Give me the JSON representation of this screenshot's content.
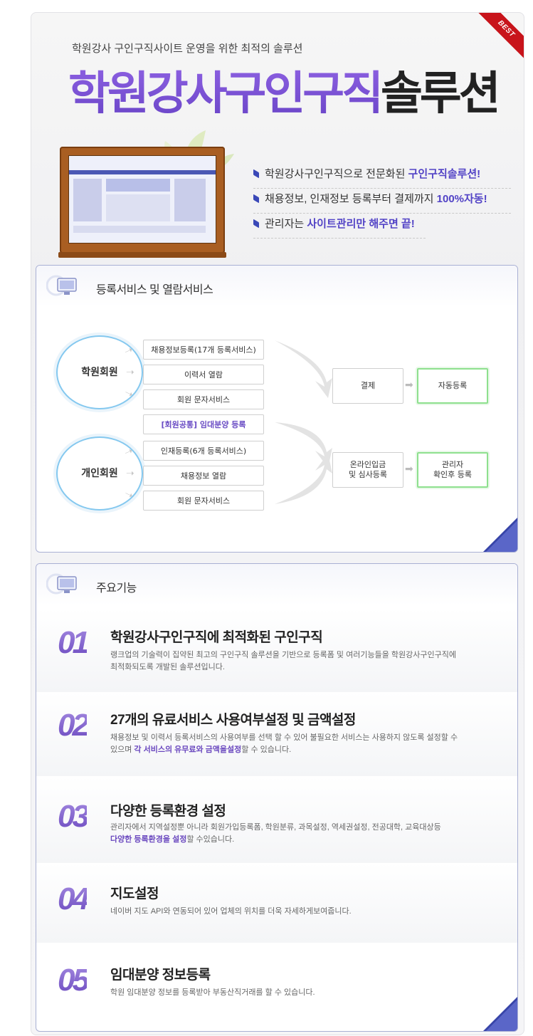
{
  "badge": "BEST",
  "hero": {
    "subtitle": "학원강사 구인구직사이트 운영을 위한 최적의 솔루션",
    "title_purple": "학원강사구인구직",
    "title_black": "솔루션",
    "bullets": [
      {
        "pre": "학원강사구인구직으로 전문화된 ",
        "hl": "구인구직솔루션!",
        "post": ""
      },
      {
        "pre": "채용정보, 인재정보 등록부터 결제까지 ",
        "hl": "100%자동!",
        "post": ""
      },
      {
        "pre": "관리자는 ",
        "hl": "사이트관리만 해주면 끝!",
        "post": ""
      }
    ]
  },
  "section1": {
    "title": "등록서비스 및 열람서비스",
    "member_academy": "학원회원",
    "member_personal": "개인회원",
    "academy_services": [
      "채용정보등록(17개 등록서비스)",
      "이력서 열람",
      "회원 문자서비스"
    ],
    "common_service": "[회원공통] 임대분양 등록",
    "personal_services": [
      "인재등록(6개 등록서비스)",
      "채용정보 열람",
      "회원 문자서비스"
    ],
    "flow_top": {
      "left": "결제",
      "right": "자동등록"
    },
    "flow_bottom": {
      "left1": "온라인입금",
      "left2": "및 심사등록",
      "right1": "관리자",
      "right2": "확인후 등록"
    }
  },
  "section2": {
    "title": "주요기능",
    "features": [
      {
        "num": "01",
        "title": "학원강사구인구직에 최적화된 구인구직",
        "desc1": "랭크업의 기술력이 집약된 최고의 구인구직 솔루션을 기반으로 등록폼 및 여러기능들을 학원강사구인구직에",
        "desc2": "최적화되도록 개발된 솔루션입니다."
      },
      {
        "num": "02",
        "title": "27개의 유료서비스 사용여부설정 및 금액설정",
        "desc1": "채용정보 및 이력서 등록서비스의 사용여부를 선택 할 수 있어 불필요한 서비스는 사용하지 않도록 설정할 수",
        "desc2_pre": "있으며 ",
        "desc2_hl": "각 서비스의 유무료와 금액을설정",
        "desc2_post": "할 수 있습니다."
      },
      {
        "num": "03",
        "title": "다양한 등록환경 설정",
        "desc1": "관리자에서 지역설정뿐 아니라 회원가입등록폼, 학원분류, 과목설정, 역세권설정, 전공대학, 교육대상등",
        "desc2_hl": "다양한 등록환경을 설정",
        "desc2_post": "할 수있습니다."
      },
      {
        "num": "04",
        "title": "지도설정",
        "desc1": "네이버 지도 API와 연동되어 있어 업체의 위치를 더욱 자세하게보여줍니다."
      },
      {
        "num": "05",
        "title": "임대분양 정보등록",
        "desc1": "학원 임대분양 정보를 등록받아 부동산직거래를 할 수 있습니다."
      }
    ]
  },
  "colors": {
    "accent_purple": "#7a56cf",
    "bullet_blue": "#3a48b8",
    "green_border": "#8ee08e",
    "circle_blue": "#84c8ef"
  }
}
